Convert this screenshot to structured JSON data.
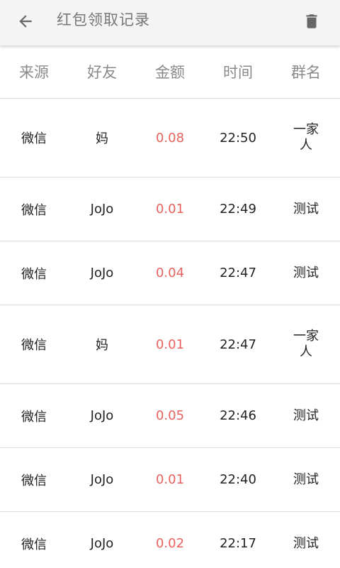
{
  "toolbar": {
    "title": "红包领取记录",
    "back_icon": "arrow-left-icon",
    "delete_icon": "trash-icon"
  },
  "table": {
    "headers": [
      "来源",
      "好友",
      "金额",
      "时间",
      "群名"
    ],
    "rows": [
      {
        "source": "微信",
        "friend": "妈",
        "amount": "0.08",
        "time": "22:50",
        "group": "一家人"
      },
      {
        "source": "微信",
        "friend": "JoJo",
        "amount": "0.01",
        "time": "22:49",
        "group": "测试"
      },
      {
        "source": "微信",
        "friend": "JoJo",
        "amount": "0.04",
        "time": "22:47",
        "group": "测试"
      },
      {
        "source": "微信",
        "friend": "妈",
        "amount": "0.01",
        "time": "22:47",
        "group": "一家人"
      },
      {
        "source": "微信",
        "friend": "JoJo",
        "amount": "0.05",
        "time": "22:46",
        "group": "测试"
      },
      {
        "source": "微信",
        "friend": "JoJo",
        "amount": "0.01",
        "time": "22:40",
        "group": "测试"
      },
      {
        "source": "微信",
        "friend": "JoJo",
        "amount": "0.02",
        "time": "22:17",
        "group": "测试"
      }
    ]
  },
  "colors": {
    "amount": "#e8615c",
    "toolbar_bg": "#f4f4f4",
    "header_text": "#8a8a8a",
    "divider": "#dcdcdc"
  }
}
